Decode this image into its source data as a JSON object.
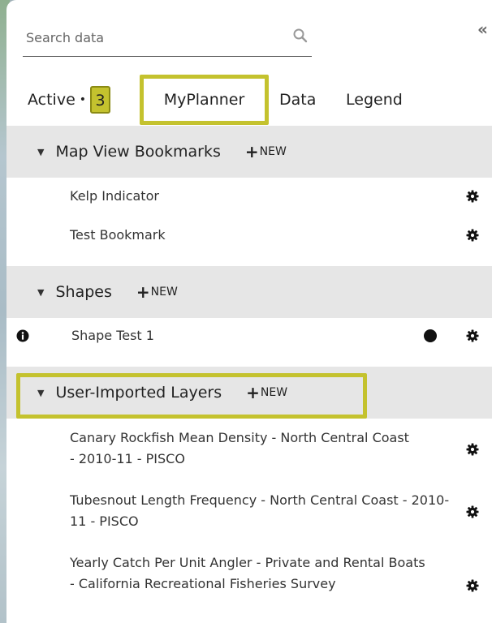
{
  "search": {
    "placeholder": "Search data"
  },
  "tabs": {
    "active_label": "Active",
    "active_separator": "•",
    "active_count": "3",
    "myplanner": "MyPlanner",
    "data": "Data",
    "legend": "Legend"
  },
  "new_label": "NEW",
  "new_plus": "+",
  "caret": "▼",
  "sections": {
    "bookmarks": {
      "title": "Map View Bookmarks",
      "items": [
        "Kelp Indicator",
        "Test Bookmark"
      ]
    },
    "shapes": {
      "title": "Shapes",
      "items": [
        "Shape Test 1"
      ]
    },
    "imported": {
      "title": "User-Imported Layers",
      "items": [
        "Canary Rockfish Mean Density - North Central Coast - 2010-11 - PISCO",
        "Tubesnout Length Frequency - North Central Coast - 2010-11 - PISCO",
        "Yearly Catch Per Unit Angler - Private and Rental Boats - California Recreational Fisheries Survey"
      ]
    }
  },
  "icons": {
    "search": "search-icon",
    "collapse": "double-chevron-left-icon",
    "gear": "gear-icon",
    "info": "info-icon",
    "circle": "circle-icon"
  },
  "colors": {
    "highlight": "#c4c22e",
    "section_bg": "#e6e6e6"
  }
}
